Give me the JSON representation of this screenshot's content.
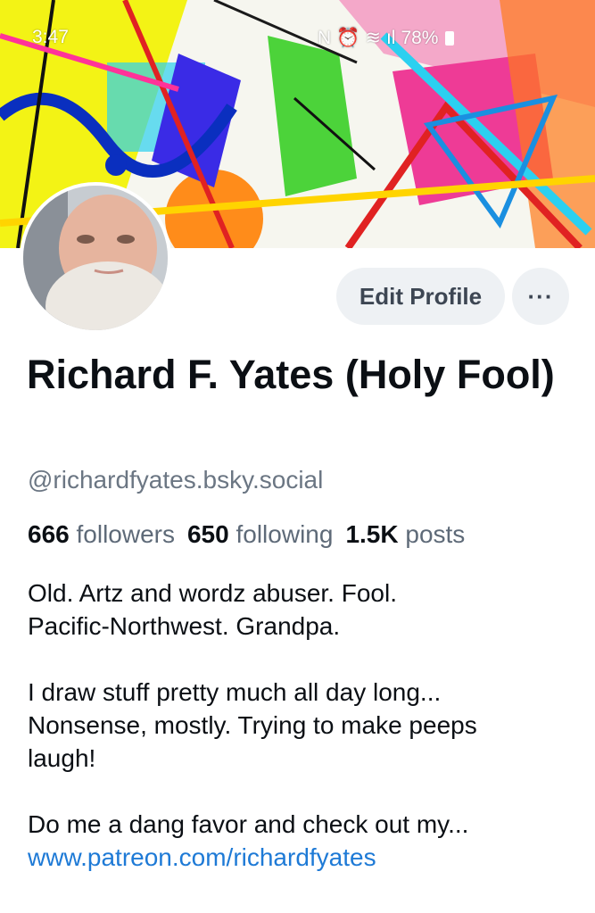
{
  "status_bar": {
    "time": "3:47",
    "battery": "78%",
    "icons": [
      "nfc-icon",
      "alarm-icon",
      "wifi-icon",
      "signal-icon",
      "battery-icon"
    ]
  },
  "profile": {
    "display_name": "Richard F. Yates (Holy Fool)",
    "handle": "@richardfyates.bsky.social",
    "followers_count": "666",
    "followers_label": "followers",
    "following_count": "650",
    "following_label": "following",
    "posts_count": "1.5K",
    "posts_label": "posts"
  },
  "actions": {
    "edit_profile_label": "Edit Profile",
    "more_label": "···"
  },
  "bio": {
    "line1": "Old. Artz and wordz abuser. Fool.",
    "line2": "Pacific-Northwest. Grandpa.",
    "line3": "I draw stuff pretty much all day long...",
    "line4": "Nonsense, mostly. Trying to make peeps",
    "line5": "laugh!",
    "line6": "Do me a dang favor and check out my...",
    "link": "www.patreon.com/richardfyates"
  },
  "colors": {
    "link": "#1e7ad6",
    "button_bg": "#eef1f4",
    "muted_text": "#5e6a78"
  }
}
